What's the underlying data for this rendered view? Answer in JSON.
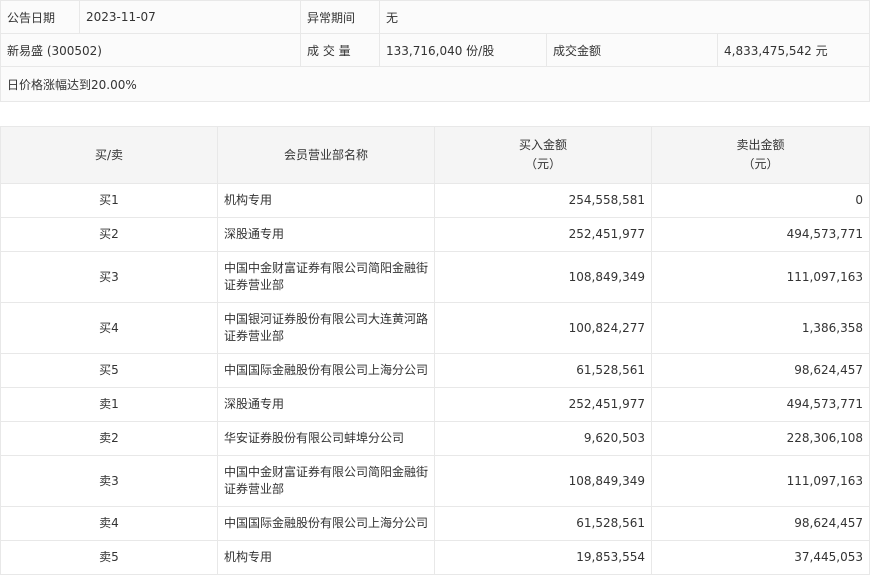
{
  "info": {
    "announce_date_label": "公告日期",
    "announce_date": "2023-11-07",
    "abnormal_period_label": "异常期间",
    "abnormal_period": "无",
    "stock": "新易盛 (300502)",
    "volume_label": "成 交 量",
    "volume": "133,716,040 份/股",
    "turnover_label": "成交金额",
    "turnover": "4,833,475,542 元",
    "reason": "日价格涨幅达到20.00%"
  },
  "table": {
    "headers": {
      "side": "买/卖",
      "dept": "会员营业部名称",
      "buy_line1": "买入金额",
      "buy_line2": "（元）",
      "sell_line1": "卖出金额",
      "sell_line2": "（元）"
    },
    "rows": [
      {
        "side": "买1",
        "dept": "机构专用",
        "buy": "254,558,581",
        "sell": "0"
      },
      {
        "side": "买2",
        "dept": "深股通专用",
        "buy": "252,451,977",
        "sell": "494,573,771"
      },
      {
        "side": "买3",
        "dept": "中国中金财富证券有限公司简阳金融街证券营业部",
        "buy": "108,849,349",
        "sell": "111,097,163"
      },
      {
        "side": "买4",
        "dept": "中国银河证券股份有限公司大连黄河路证券营业部",
        "buy": "100,824,277",
        "sell": "1,386,358"
      },
      {
        "side": "买5",
        "dept": "中国国际金融股份有限公司上海分公司",
        "buy": "61,528,561",
        "sell": "98,624,457"
      },
      {
        "side": "卖1",
        "dept": "深股通专用",
        "buy": "252,451,977",
        "sell": "494,573,771"
      },
      {
        "side": "卖2",
        "dept": "华安证券股份有限公司蚌埠分公司",
        "buy": "9,620,503",
        "sell": "228,306,108"
      },
      {
        "side": "卖3",
        "dept": "中国中金财富证券有限公司简阳金融街证券营业部",
        "buy": "108,849,349",
        "sell": "111,097,163"
      },
      {
        "side": "卖4",
        "dept": "中国国际金融股份有限公司上海分公司",
        "buy": "61,528,561",
        "sell": "98,624,457"
      },
      {
        "side": "卖5",
        "dept": "机构专用",
        "buy": "19,853,554",
        "sell": "37,445,053"
      }
    ]
  }
}
